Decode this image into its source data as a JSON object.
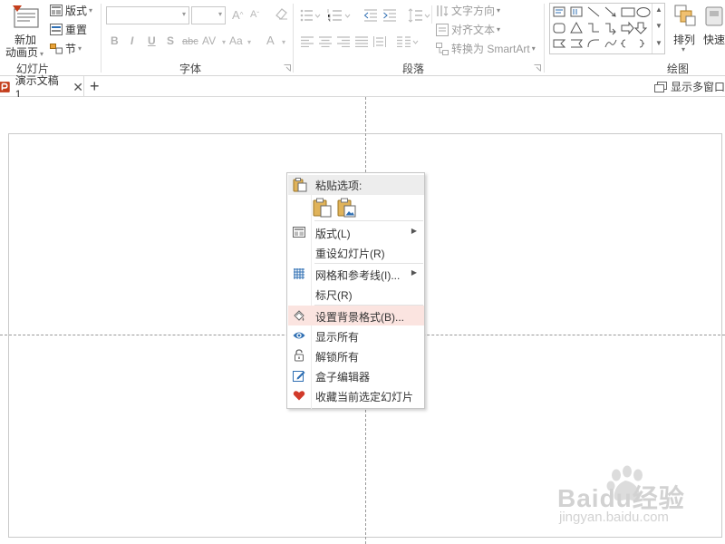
{
  "ribbon": {
    "groups": {
      "slides": "幻灯片",
      "font": "字体",
      "paragraph": "段落",
      "drawing": "绘图"
    },
    "new_slide": {
      "line1": "新加",
      "line2": "动画页"
    },
    "layout": "版式",
    "reset": "重置",
    "section": "节",
    "font_buttons": [
      "B",
      "I",
      "U",
      "S",
      "abc",
      "AV",
      "Aa",
      "A"
    ],
    "text_direction": "文字方向",
    "align_text": "对齐文本",
    "convert_smartart": "转换为 SmartArt",
    "arrange": "排列",
    "quick_styles": "快速"
  },
  "tabbar": {
    "doc_tab": "演示文稿1",
    "add_tab": "+",
    "show_multi_window": "显示多窗口"
  },
  "context_menu": {
    "paste_options_header": "粘贴选项:",
    "items": [
      {
        "label": "版式(L)",
        "icon": "layout-icon",
        "submenu": true
      },
      {
        "label": "重设幻灯片(R)",
        "icon": "",
        "submenu": false
      },
      {
        "label": "网格和参考线(I)...",
        "icon": "grid-icon",
        "submenu": true
      },
      {
        "label": "标尺(R)",
        "icon": "",
        "submenu": false
      },
      {
        "label": "设置背景格式(B)...",
        "icon": "background-format-icon",
        "submenu": false,
        "highlighted": true
      },
      {
        "label": "显示所有",
        "icon": "eye-icon",
        "submenu": false
      },
      {
        "label": "解锁所有",
        "icon": "unlock-icon",
        "submenu": false
      },
      {
        "label": "盒子编辑器",
        "icon": "edit-icon",
        "submenu": false
      },
      {
        "label": "收藏当前选定幻灯片",
        "icon": "heart-icon",
        "submenu": false
      }
    ]
  },
  "watermark": {
    "brand": "Baidu经验",
    "site": "jingyan.baidu.com"
  },
  "colors": {
    "accent_red": "#c43e1c",
    "highlight": "#fbe4e0",
    "heart": "#d13a2a",
    "eye_blue": "#2f6fb3"
  }
}
